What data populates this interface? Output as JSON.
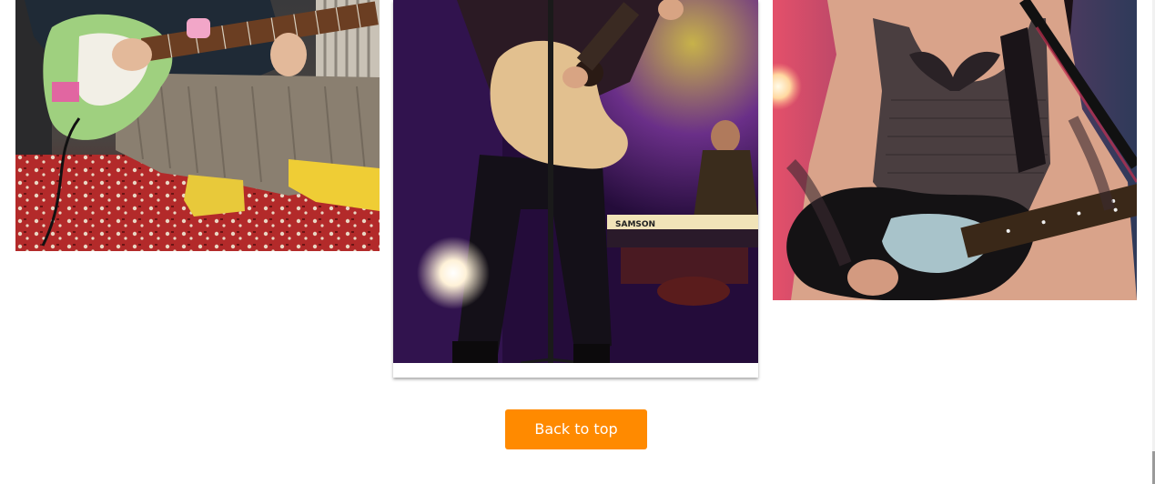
{
  "gallery": {
    "items": [
      {
        "image": "guitarist-sitting-on-rug-green-electric-guitar"
      },
      {
        "image": "acoustic-guitarist-on-stage-with-keyboard-player"
      },
      {
        "image": "tattooed-woman-playing-electric-guitar"
      }
    ]
  },
  "back_to_top": {
    "label": "Back to top"
  },
  "colors": {
    "accent": "#ff8a00",
    "button_text": "#ffffff",
    "background": "#ffffff"
  }
}
